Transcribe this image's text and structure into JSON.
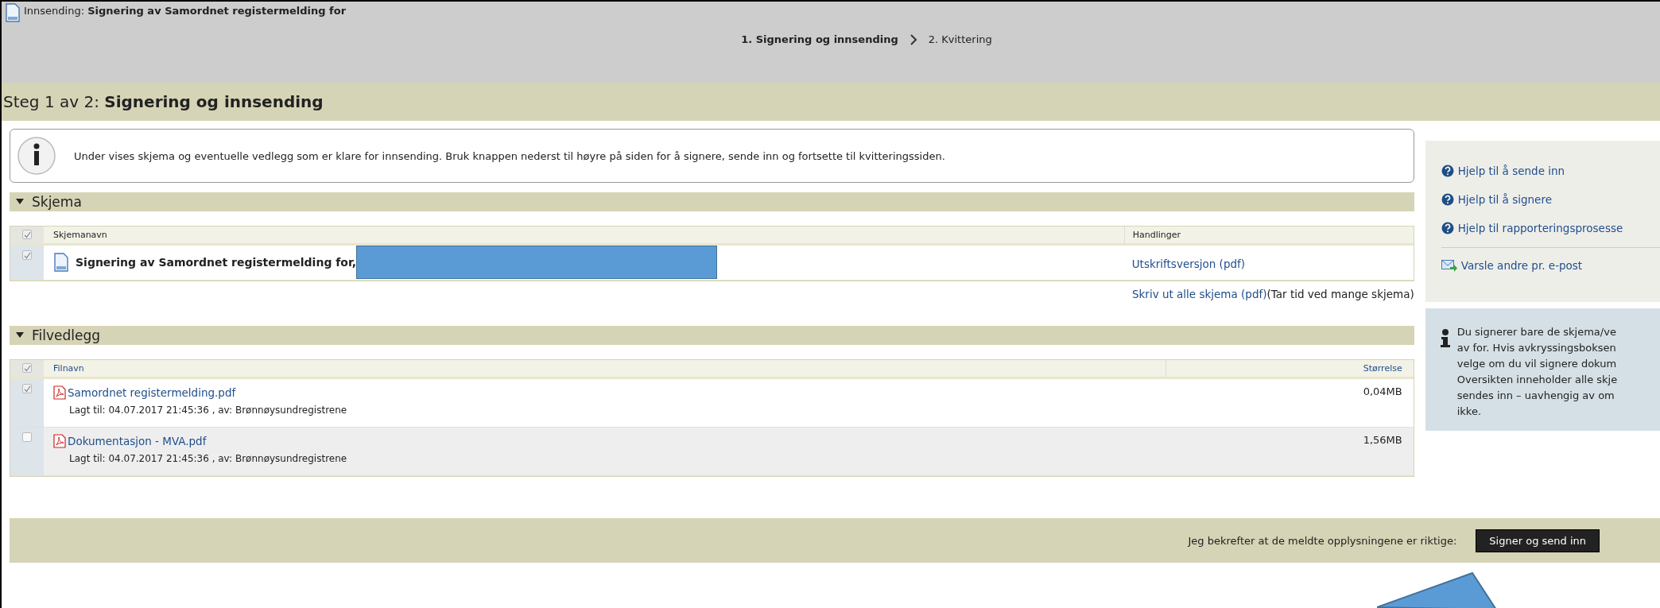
{
  "header": {
    "prefix": "Innsending:",
    "title": "Signering av Samordnet registermelding for"
  },
  "steps": [
    {
      "label": "1. Signering og innsending",
      "selected": true
    },
    {
      "label": "2. Kvittering",
      "selected": false
    }
  ],
  "page_title": {
    "prefix": "Steg 1 av 2:",
    "title": "Signering og innsending"
  },
  "info": "Under vises skjema og eventuelle vedlegg som er klare for innsending. Bruk knappen nederst til høyre på siden for å signere, sende inn og fortsette til kvitteringssiden.",
  "forms_section": {
    "title": "Skjema",
    "expanded": true,
    "header_checked": true,
    "columns": [
      "Skjemanavn",
      "Handlinger"
    ],
    "rows": [
      {
        "checked": true,
        "name": "Signering av Samordnet registermelding for,",
        "action": "Utskriftsversjon (pdf)"
      }
    ],
    "print_all_link": "Skriv ut alle skjema (pdf)",
    "print_all_note": "(Tar tid ved mange skjema)"
  },
  "attachments_section": {
    "title": "Filvedlegg",
    "expanded": true,
    "header_checked": true,
    "columns": [
      "Filnavn",
      "Størrelse"
    ],
    "rows": [
      {
        "checked": true,
        "name": "Samordnet registermelding.pdf",
        "meta": "Lagt til: 04.07.2017 21:45:36 , av: Brønnøysundregistrene",
        "size": "0,04MB"
      },
      {
        "checked": false,
        "name": "Dokumentasjon - MVA.pdf",
        "meta": "Lagt til: 04.07.2017 21:45:36 , av: Brønnøysundregistrene",
        "size": "1,56MB"
      }
    ]
  },
  "confirm_text": "Jeg bekrefter at de meldte opplysningene er riktige:",
  "submit_button": "Signer og send inn",
  "sidebar": {
    "help_links": [
      "Hjelp til å sende inn",
      "Hjelp til å signere",
      "Hjelp til rapporteringsprosesse"
    ],
    "notify_link": "Varsle andre pr. e-post",
    "note_lines": [
      "Du signerer bare de skjema/ve",
      "av for. Hvis avkryssingsboksen",
      "velge om du vil signere dokum",
      "Oversikten inneholder alle skje",
      "sendes inn – uavhengig av om",
      "ikke."
    ]
  }
}
